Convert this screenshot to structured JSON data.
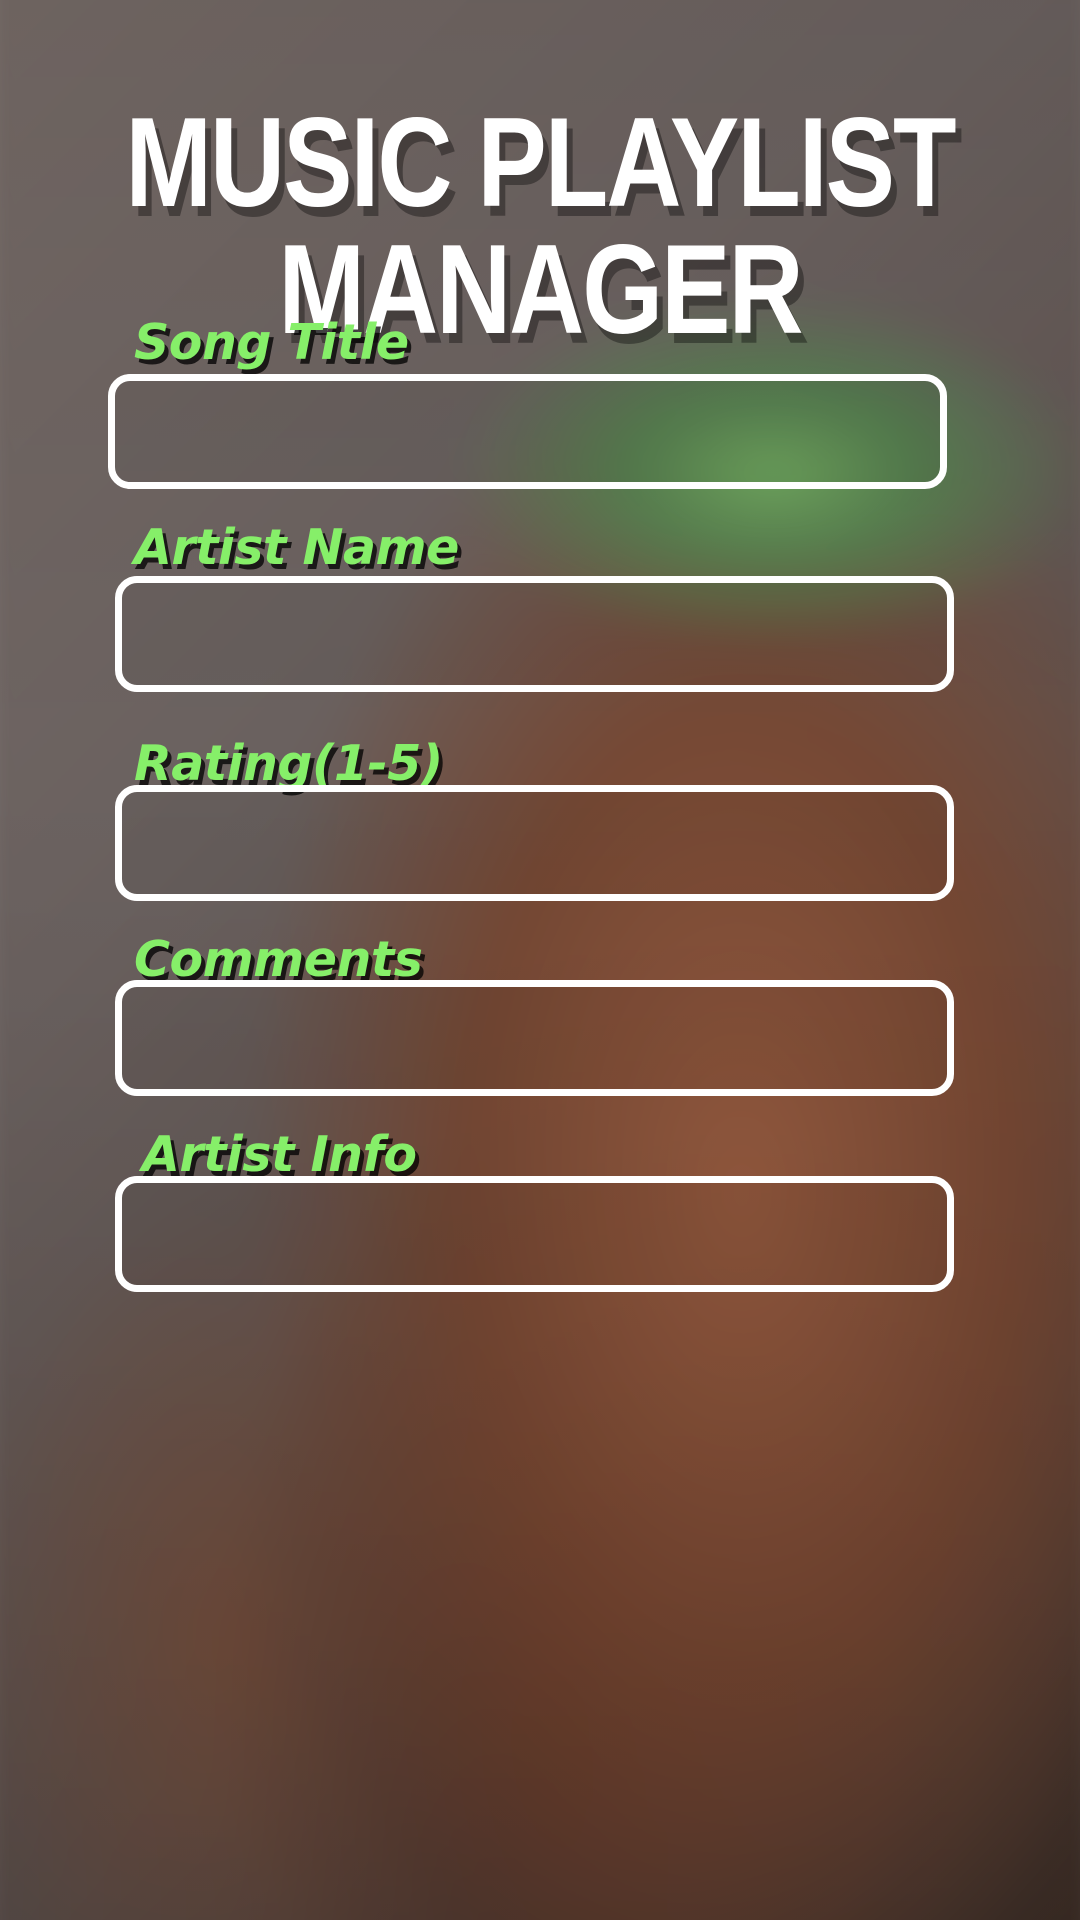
{
  "app": {
    "title": "MUSIC  PLAYLIST MANAGER"
  },
  "form": {
    "fields": [
      {
        "label": "Song Title",
        "value": "",
        "placeholder": ""
      },
      {
        "label": "Artist Name",
        "value": "",
        "placeholder": ""
      },
      {
        "label": "Rating(1-5)",
        "value": "",
        "placeholder": ""
      },
      {
        "label": "Comments",
        "value": "",
        "placeholder": ""
      },
      {
        "label": "Artist Info",
        "value": "",
        "placeholder": ""
      }
    ]
  },
  "colors": {
    "label": "#86ef69",
    "title": "#ffffff",
    "field_border": "#ffffff"
  }
}
